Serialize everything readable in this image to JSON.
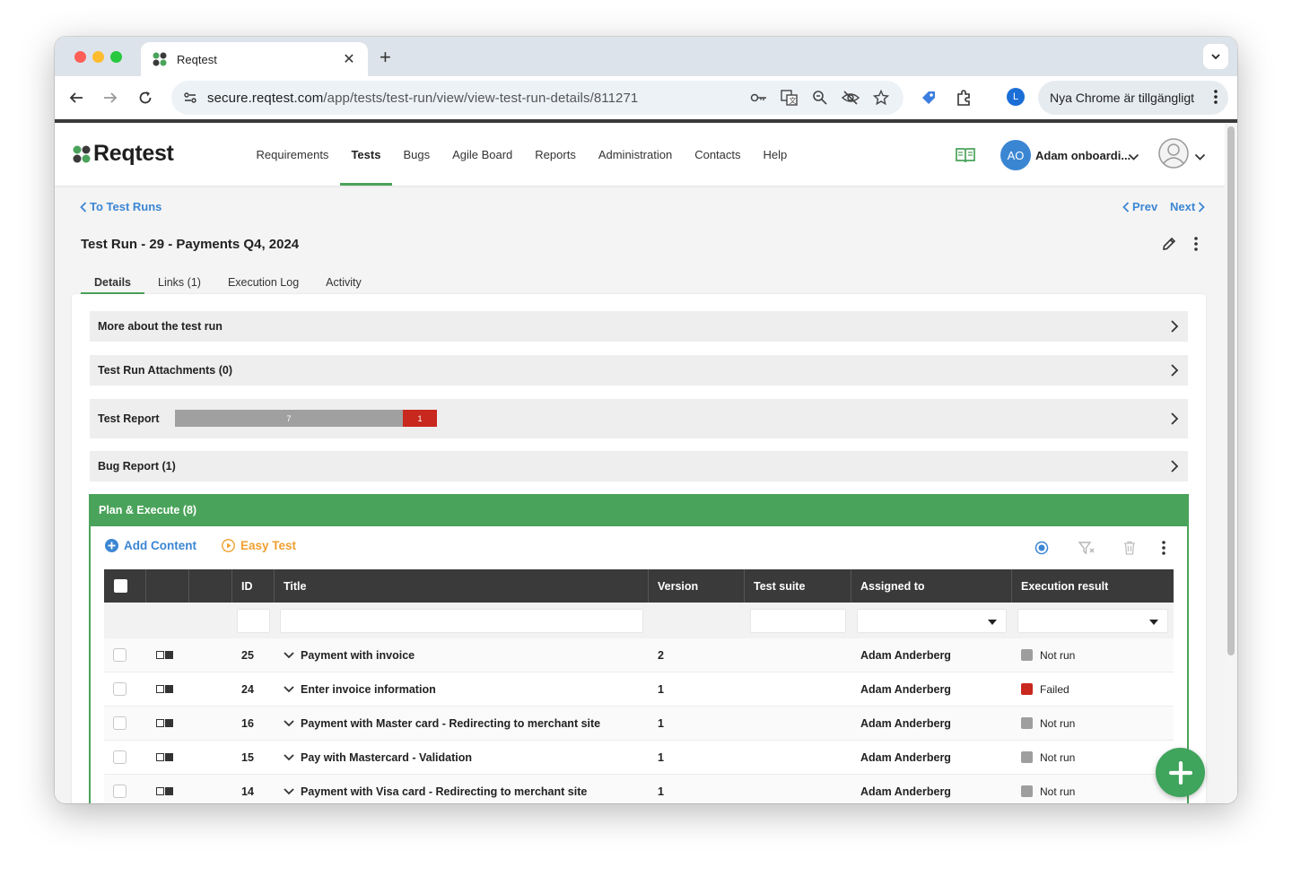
{
  "browser": {
    "tab_title": "Reqtest",
    "url_host": "secure.reqtest.com",
    "url_path": "/app/tests/test-run/view/view-test-run-details/811271",
    "profile_initial": "L",
    "update_label": "Nya Chrome är tillgängligt"
  },
  "app": {
    "logo_text": "Reqtest",
    "nav": [
      {
        "label": "Requirements",
        "active": false
      },
      {
        "label": "Tests",
        "active": true
      },
      {
        "label": "Bugs",
        "active": false
      },
      {
        "label": "Agile Board",
        "active": false
      },
      {
        "label": "Reports",
        "active": false
      },
      {
        "label": "Administration",
        "active": false
      },
      {
        "label": "Contacts",
        "active": false
      },
      {
        "label": "Help",
        "active": false
      }
    ],
    "project_initials": "AO",
    "project_name": "Adam onboardi...",
    "brand_color": "#4aa35a",
    "link_color": "#3b86d3"
  },
  "subheader": {
    "back_label": "To Test Runs",
    "prev_label": "Prev",
    "next_label": "Next",
    "title": "Test Run - 29 - Payments Q4, 2024",
    "tabs": [
      "Details",
      "Links (1)",
      "Execution Log",
      "Activity"
    ]
  },
  "sections": {
    "more_about": "More about the test run",
    "attachments": "Test Run Attachments (0)",
    "test_report": "Test Report",
    "report_counts": {
      "not_run": 7,
      "failed": 1
    },
    "bug_report": "Bug Report (1)"
  },
  "plan": {
    "title": "Plan & Execute (8)",
    "add_content": "Add Content",
    "easy_test": "Easy Test",
    "columns": [
      "ID",
      "Title",
      "Version",
      "Test suite",
      "Assigned to",
      "Execution result"
    ],
    "rows": [
      {
        "id": "25",
        "title": "Payment with invoice",
        "version": "2",
        "suite": "",
        "assigned": "Adam Anderberg",
        "result": "Not run",
        "status_color": "#9e9e9e"
      },
      {
        "id": "24",
        "title": "Enter invoice information",
        "version": "1",
        "suite": "",
        "assigned": "Adam Anderberg",
        "result": "Failed",
        "status_color": "#c8281e"
      },
      {
        "id": "16",
        "title": "Payment with Master card - Redirecting to merchant site",
        "version": "1",
        "suite": "",
        "assigned": "Adam Anderberg",
        "result": "Not run",
        "status_color": "#9e9e9e"
      },
      {
        "id": "15",
        "title": "Pay with Mastercard - Validation",
        "version": "1",
        "suite": "",
        "assigned": "Adam Anderberg",
        "result": "Not run",
        "status_color": "#9e9e9e"
      },
      {
        "id": "14",
        "title": "Payment with Visa card - Redirecting to merchant site",
        "version": "1",
        "suite": "",
        "assigned": "Adam Anderberg",
        "result": "Not run",
        "status_color": "#9e9e9e"
      }
    ]
  }
}
